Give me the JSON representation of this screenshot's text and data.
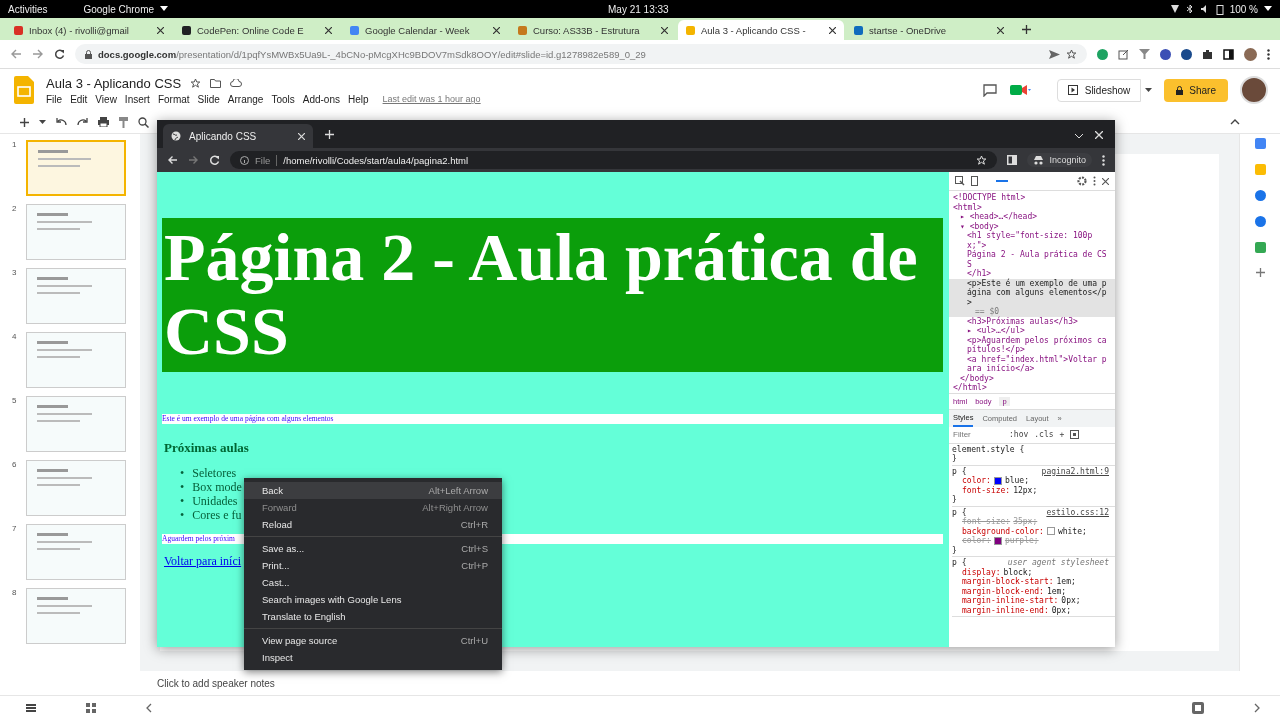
{
  "top_bar": {
    "activities": "Activities",
    "app": "Google Chrome",
    "clock": "May 21  13:33",
    "battery": "100 %"
  },
  "browser": {
    "tabs": [
      {
        "title": "Inbox (4) - rivolli@gmail",
        "selected": false,
        "color": "#d93025"
      },
      {
        "title": "CodePen: Online Code E",
        "selected": false,
        "color": "#202124"
      },
      {
        "title": "Google Calendar - Week",
        "selected": false,
        "color": "#4285f4"
      },
      {
        "title": "Curso: AS33B - Estrutura",
        "selected": false,
        "color": "#c5791d"
      },
      {
        "title": "Aula 3 - Aplicando CSS -",
        "selected": true,
        "color": "#f4b400"
      },
      {
        "title": "startse - OneDrive",
        "selected": false,
        "color": "#0f6cbd"
      }
    ],
    "url_host": "docs.google.com",
    "url_path": "/presentation/d/1pqfYsMWBx5Ua9L-_4bCNo-pMcgXHc9BDOV7mSdk8OOY/edit#slide=id.g1278982e589_0_29"
  },
  "slides": {
    "title": "Aula 3 - Aplicando CSS",
    "menu": [
      "File",
      "Edit",
      "View",
      "Insert",
      "Format",
      "Slide",
      "Arrange",
      "Tools",
      "Add-ons",
      "Help"
    ],
    "last_edit": "Last edit was 1 hour ago",
    "slideshow": "Slideshow",
    "share": "Share",
    "thumbnails": [
      {
        "number": "1",
        "selected": true
      },
      {
        "number": "2",
        "selected": false
      },
      {
        "number": "3",
        "selected": false
      },
      {
        "number": "4",
        "selected": false
      },
      {
        "number": "5",
        "selected": false
      },
      {
        "number": "6",
        "selected": false
      },
      {
        "number": "7",
        "selected": false
      },
      {
        "number": "8",
        "selected": false
      }
    ],
    "speaker_notes": "Click to add speaker notes"
  },
  "popup": {
    "tab_title": "Aplicando CSS",
    "scheme": "File",
    "path": "/home/rivolli/Codes/start/aula4/pagina2.html",
    "incognito": "Incognito",
    "page": {
      "heading": "Página 2 - Aula prática de CSS",
      "intro": "Este é um exemplo de uma página com alguns elementos",
      "subheading": "Próximas aulas",
      "list": [
        {
          "marker": "•",
          "text": "Seletores"
        },
        {
          "marker": "•",
          "text": "Box mode"
        },
        {
          "marker": "•",
          "text": "Unidades"
        },
        {
          "marker": "•",
          "text": "Cores e fu"
        }
      ],
      "closing": "Aguardem pelos próxim",
      "link": "Voltar para iníci"
    },
    "devtools": {
      "tree": [
        {
          "text": "<!DOCTYPE html>",
          "selected": false
        },
        {
          "text": "<html>",
          "selected": false,
          "children": [
            {
              "text": "▸ <head>…</head>",
              "selected": false
            },
            {
              "text": "▾ <body>",
              "selected": false,
              "children": [
                {
                  "text": "<h1 style=\"font-size: 100px;\">",
                  "selected": false
                },
                {
                  "text": "Página 2 - Aula prática de CSS",
                  "selected": false
                },
                {
                  "text": "</h1>",
                  "selected": false
                },
                {
                  "text": "<p>Este é um exemplo de uma página com alguns elementos</p>",
                  "note": "== $0",
                  "selected": true
                },
                {
                  "text": "<h3>Próximas aulas</h3>",
                  "selected": false
                },
                {
                  "text": "▸ <ul>…</ul>",
                  "selected": false
                },
                {
                  "text": "<p>Aguardem pelos próximos capítulos!</p>",
                  "selected": false
                },
                {
                  "text": "<a href=\"index.html\">Voltar para início</a>",
                  "selected": false
                }
              ]
            },
            {
              "text": "</body>",
              "selected": false
            }
          ]
        },
        {
          "text": "</html>",
          "selected": false
        }
      ],
      "breadcrumbs": [
        {
          "label": "html",
          "selected": false
        },
        {
          "label": "body",
          "selected": false
        },
        {
          "label": "p",
          "selected": true
        }
      ],
      "tabs": [
        {
          "label": "Styles",
          "selected": true
        },
        {
          "label": "Computed",
          "selected": false
        },
        {
          "label": "Layout",
          "selected": false
        },
        {
          "label": "»",
          "selected": false
        }
      ],
      "filter_placeholder": "Filter",
      "hov": ":hov",
      "cls": ".cls",
      "add": "+",
      "rules": [
        {
          "selector": "element.style {",
          "close": "}"
        },
        {
          "selector": "p {",
          "source": "pagina2.html:9",
          "props": [
            {
              "name": "color:",
              "value": "blue;",
              "struck": false,
              "color": "#0000ff"
            },
            {
              "name": "font-size:",
              "value": "12px;",
              "struck": false
            }
          ],
          "close": "}"
        },
        {
          "selector": "p {",
          "source": "estilo.css:12",
          "props": [
            {
              "name": "font-size:",
              "value": "35px;",
              "struck": true
            },
            {
              "name": "background-color:",
              "value": "white;",
              "struck": false,
              "color": "#ffffff"
            },
            {
              "name": "color:",
              "value": "purple;",
              "struck": true,
              "color": "#800080"
            }
          ],
          "close": "}"
        },
        {
          "selector": "p {",
          "source": "user agent stylesheet",
          "props": [
            {
              "name": "display:",
              "value": "block;",
              "struck": false
            },
            {
              "name": "margin-block-start:",
              "value": "1em;",
              "struck": false
            },
            {
              "name": "margin-block-end:",
              "value": "1em;",
              "struck": false
            },
            {
              "name": "margin-inline-start:",
              "value": "0px;",
              "struck": false
            },
            {
              "name": "margin-inline-end:",
              "value": "0px;",
              "struck": false
            }
          ]
        }
      ]
    }
  },
  "context_menu": {
    "groups": [
      {
        "items": [
          {
            "label": "Back",
            "shortcut": "Alt+Left Arrow",
            "selected": true,
            "disabled": false
          },
          {
            "label": "Forward",
            "shortcut": "Alt+Right Arrow",
            "selected": false,
            "disabled": true
          },
          {
            "label": "Reload",
            "shortcut": "Ctrl+R",
            "selected": false,
            "disabled": false
          }
        ]
      },
      {
        "items": [
          {
            "label": "Save as...",
            "shortcut": "Ctrl+S",
            "selected": false,
            "disabled": false
          },
          {
            "label": "Print...",
            "shortcut": "Ctrl+P",
            "selected": false,
            "disabled": false
          },
          {
            "label": "Cast...",
            "selected": false,
            "disabled": false
          },
          {
            "label": "Search images with Google Lens",
            "selected": false,
            "disabled": false
          },
          {
            "label": "Translate to English",
            "selected": false,
            "disabled": false
          }
        ]
      },
      {
        "items": [
          {
            "label": "View page source",
            "shortcut": "Ctrl+U",
            "selected": false,
            "disabled": false
          },
          {
            "label": "Inspect",
            "selected": false,
            "disabled": false
          }
        ]
      }
    ]
  }
}
